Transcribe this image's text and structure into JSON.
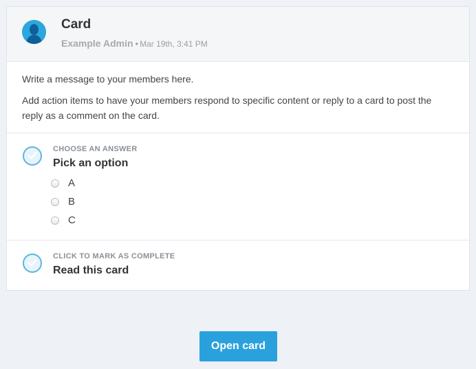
{
  "card": {
    "title": "Card",
    "author": "Example Admin",
    "separator": "•",
    "date": "Mar 19th, 3:41 PM",
    "avatar_icon": "user-silhouette-icon"
  },
  "body": {
    "paragraphs": [
      "Write a message to your members here.",
      "Add action items to have your members respond to specific content or reply to a card to post the reply as a comment on the card."
    ]
  },
  "actions": [
    {
      "kicker": "CHOOSE AN ANSWER",
      "title": "Pick an option",
      "options": [
        "A",
        "B",
        "C"
      ],
      "icon": "check-circle-icon"
    },
    {
      "kicker": "CLICK TO MARK AS COMPLETE",
      "title": "Read this card",
      "icon": "check-circle-icon"
    }
  ],
  "footer": {
    "open_label": "Open card"
  },
  "colors": {
    "accent": "#2aa1dd",
    "check_ring": "#5bb5e0",
    "background": "#eef1f6"
  }
}
